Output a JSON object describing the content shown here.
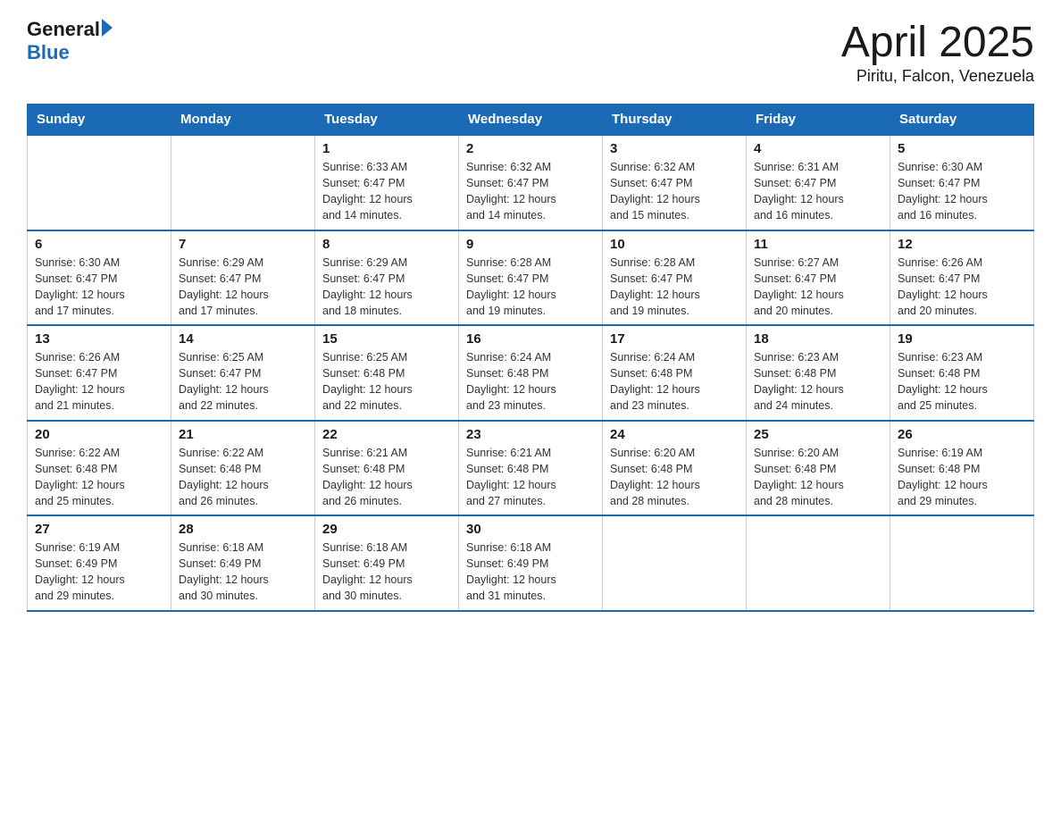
{
  "logo": {
    "text_general": "General",
    "text_blue": "Blue"
  },
  "title": "April 2025",
  "subtitle": "Piritu, Falcon, Venezuela",
  "headers": [
    "Sunday",
    "Monday",
    "Tuesday",
    "Wednesday",
    "Thursday",
    "Friday",
    "Saturday"
  ],
  "weeks": [
    [
      {
        "day": "",
        "info": ""
      },
      {
        "day": "",
        "info": ""
      },
      {
        "day": "1",
        "info": "Sunrise: 6:33 AM\nSunset: 6:47 PM\nDaylight: 12 hours\nand 14 minutes."
      },
      {
        "day": "2",
        "info": "Sunrise: 6:32 AM\nSunset: 6:47 PM\nDaylight: 12 hours\nand 14 minutes."
      },
      {
        "day": "3",
        "info": "Sunrise: 6:32 AM\nSunset: 6:47 PM\nDaylight: 12 hours\nand 15 minutes."
      },
      {
        "day": "4",
        "info": "Sunrise: 6:31 AM\nSunset: 6:47 PM\nDaylight: 12 hours\nand 16 minutes."
      },
      {
        "day": "5",
        "info": "Sunrise: 6:30 AM\nSunset: 6:47 PM\nDaylight: 12 hours\nand 16 minutes."
      }
    ],
    [
      {
        "day": "6",
        "info": "Sunrise: 6:30 AM\nSunset: 6:47 PM\nDaylight: 12 hours\nand 17 minutes."
      },
      {
        "day": "7",
        "info": "Sunrise: 6:29 AM\nSunset: 6:47 PM\nDaylight: 12 hours\nand 17 minutes."
      },
      {
        "day": "8",
        "info": "Sunrise: 6:29 AM\nSunset: 6:47 PM\nDaylight: 12 hours\nand 18 minutes."
      },
      {
        "day": "9",
        "info": "Sunrise: 6:28 AM\nSunset: 6:47 PM\nDaylight: 12 hours\nand 19 minutes."
      },
      {
        "day": "10",
        "info": "Sunrise: 6:28 AM\nSunset: 6:47 PM\nDaylight: 12 hours\nand 19 minutes."
      },
      {
        "day": "11",
        "info": "Sunrise: 6:27 AM\nSunset: 6:47 PM\nDaylight: 12 hours\nand 20 minutes."
      },
      {
        "day": "12",
        "info": "Sunrise: 6:26 AM\nSunset: 6:47 PM\nDaylight: 12 hours\nand 20 minutes."
      }
    ],
    [
      {
        "day": "13",
        "info": "Sunrise: 6:26 AM\nSunset: 6:47 PM\nDaylight: 12 hours\nand 21 minutes."
      },
      {
        "day": "14",
        "info": "Sunrise: 6:25 AM\nSunset: 6:47 PM\nDaylight: 12 hours\nand 22 minutes."
      },
      {
        "day": "15",
        "info": "Sunrise: 6:25 AM\nSunset: 6:48 PM\nDaylight: 12 hours\nand 22 minutes."
      },
      {
        "day": "16",
        "info": "Sunrise: 6:24 AM\nSunset: 6:48 PM\nDaylight: 12 hours\nand 23 minutes."
      },
      {
        "day": "17",
        "info": "Sunrise: 6:24 AM\nSunset: 6:48 PM\nDaylight: 12 hours\nand 23 minutes."
      },
      {
        "day": "18",
        "info": "Sunrise: 6:23 AM\nSunset: 6:48 PM\nDaylight: 12 hours\nand 24 minutes."
      },
      {
        "day": "19",
        "info": "Sunrise: 6:23 AM\nSunset: 6:48 PM\nDaylight: 12 hours\nand 25 minutes."
      }
    ],
    [
      {
        "day": "20",
        "info": "Sunrise: 6:22 AM\nSunset: 6:48 PM\nDaylight: 12 hours\nand 25 minutes."
      },
      {
        "day": "21",
        "info": "Sunrise: 6:22 AM\nSunset: 6:48 PM\nDaylight: 12 hours\nand 26 minutes."
      },
      {
        "day": "22",
        "info": "Sunrise: 6:21 AM\nSunset: 6:48 PM\nDaylight: 12 hours\nand 26 minutes."
      },
      {
        "day": "23",
        "info": "Sunrise: 6:21 AM\nSunset: 6:48 PM\nDaylight: 12 hours\nand 27 minutes."
      },
      {
        "day": "24",
        "info": "Sunrise: 6:20 AM\nSunset: 6:48 PM\nDaylight: 12 hours\nand 28 minutes."
      },
      {
        "day": "25",
        "info": "Sunrise: 6:20 AM\nSunset: 6:48 PM\nDaylight: 12 hours\nand 28 minutes."
      },
      {
        "day": "26",
        "info": "Sunrise: 6:19 AM\nSunset: 6:48 PM\nDaylight: 12 hours\nand 29 minutes."
      }
    ],
    [
      {
        "day": "27",
        "info": "Sunrise: 6:19 AM\nSunset: 6:49 PM\nDaylight: 12 hours\nand 29 minutes."
      },
      {
        "day": "28",
        "info": "Sunrise: 6:18 AM\nSunset: 6:49 PM\nDaylight: 12 hours\nand 30 minutes."
      },
      {
        "day": "29",
        "info": "Sunrise: 6:18 AM\nSunset: 6:49 PM\nDaylight: 12 hours\nand 30 minutes."
      },
      {
        "day": "30",
        "info": "Sunrise: 6:18 AM\nSunset: 6:49 PM\nDaylight: 12 hours\nand 31 minutes."
      },
      {
        "day": "",
        "info": ""
      },
      {
        "day": "",
        "info": ""
      },
      {
        "day": "",
        "info": ""
      }
    ]
  ]
}
